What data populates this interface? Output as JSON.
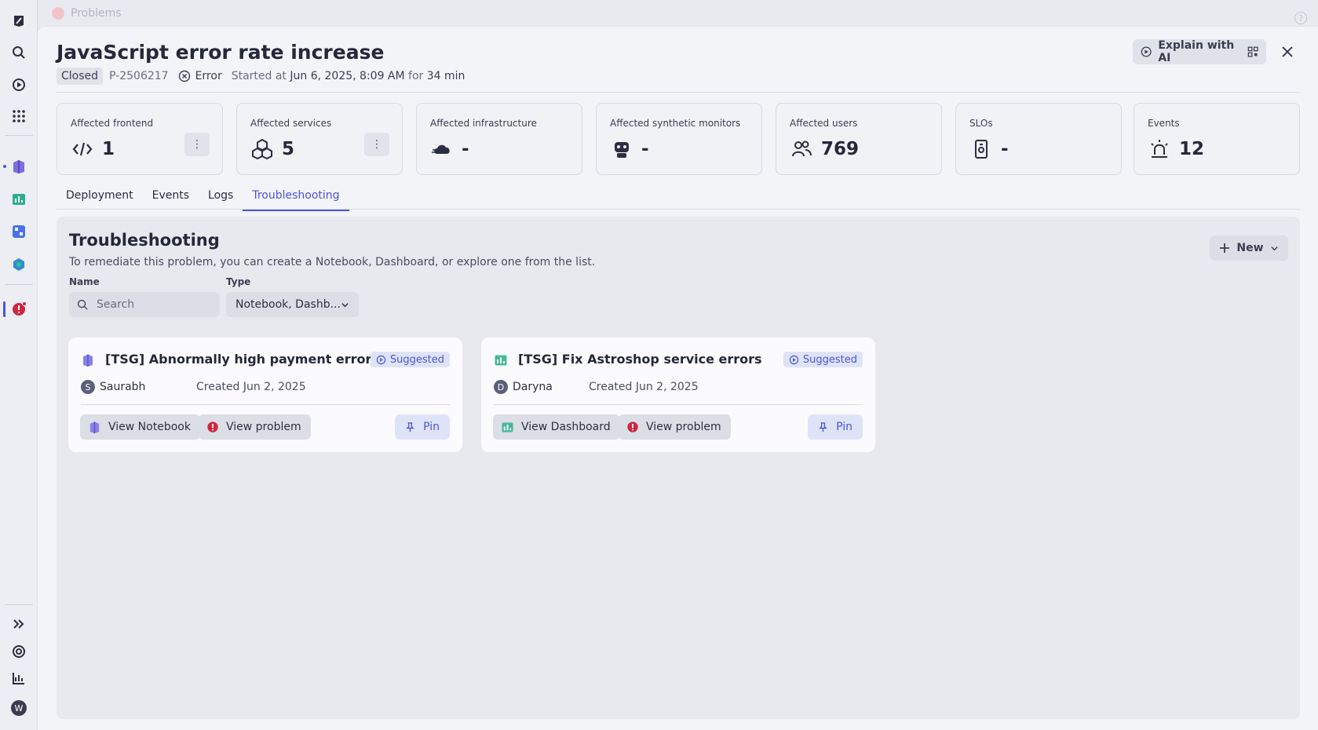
{
  "topbar": {
    "breadcrumb": "Problems"
  },
  "problem": {
    "title": "JavaScript error rate increase",
    "status": "Closed",
    "id": "P-2506217",
    "severity": "Error",
    "started_prefix": "Started at",
    "started_at": "Jun 6, 2025, 8:09 AM",
    "duration_prefix": "for",
    "duration": "34 min"
  },
  "header": {
    "explain_label": "Explain with AI"
  },
  "metrics": [
    {
      "label": "Affected frontend",
      "value": "1",
      "icon": "code-icon",
      "has_more": true
    },
    {
      "label": "Affected services",
      "value": "5",
      "icon": "cubes-icon",
      "has_more": true
    },
    {
      "label": "Affected infrastructure",
      "value": "-",
      "icon": "cloud-icon",
      "has_more": false
    },
    {
      "label": "Affected synthetic monitors",
      "value": "-",
      "icon": "robot-icon",
      "has_more": false
    },
    {
      "label": "Affected users",
      "value": "769",
      "icon": "users-icon",
      "has_more": false
    },
    {
      "label": "SLOs",
      "value": "-",
      "icon": "slo-icon",
      "has_more": false
    },
    {
      "label": "Events",
      "value": "12",
      "icon": "alarm-icon",
      "has_more": false
    }
  ],
  "tabs": [
    {
      "label": "Deployment"
    },
    {
      "label": "Events"
    },
    {
      "label": "Logs"
    },
    {
      "label": "Troubleshooting",
      "active": true
    }
  ],
  "troubleshooting": {
    "title": "Troubleshooting",
    "description": "To remediate this problem, you can create a Notebook, Dashboard, or explore one from the list.",
    "new_label": "New",
    "name_label": "Name",
    "search_placeholder": "Search",
    "type_label": "Type",
    "type_value": "Notebook, Dashb...",
    "cards": [
      {
        "title": "[TSG] Abnormally high payment errors",
        "badge": "Suggested",
        "owner_initial": "S",
        "owner": "Saurabh",
        "created": "Created Jun 2, 2025",
        "view_label": "View Notebook",
        "problem_label": "View problem",
        "pin_label": "Pin",
        "kind": "notebook"
      },
      {
        "title": "[TSG] Fix Astroshop service errors",
        "badge": "Suggested",
        "owner_initial": "D",
        "owner": "Daryna",
        "created": "Created Jun 2, 2025",
        "view_label": "View Dashboard",
        "problem_label": "View problem",
        "pin_label": "Pin",
        "kind": "dashboard"
      }
    ]
  },
  "rail": {
    "profile_initial": "W"
  },
  "colors": {
    "accent": "#4b55d6",
    "error": "#d0263f",
    "panel": "#f3f4f8"
  }
}
